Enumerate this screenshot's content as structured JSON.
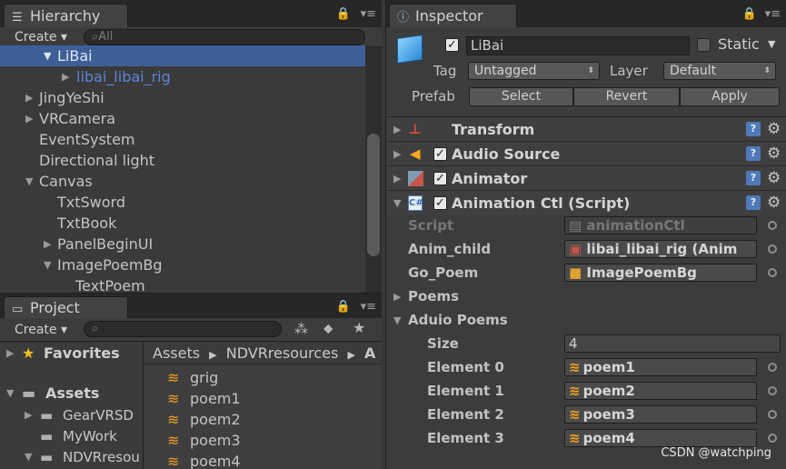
{
  "hierarchy": {
    "tab_label": "Hierarchy",
    "create_label": "Create",
    "search_placeholder": "All",
    "rows": [
      {
        "label": "LiBai",
        "selected": true,
        "arrow": "down"
      },
      {
        "label": "libai_libai_rig",
        "arrow": "right"
      },
      {
        "label": "JingYeShi",
        "arrow": "right"
      },
      {
        "label": "VRCamera",
        "arrow": "right"
      },
      {
        "label": "EventSystem"
      },
      {
        "label": "Directional light"
      },
      {
        "label": "Canvas",
        "arrow": "down"
      },
      {
        "label": "TxtSword"
      },
      {
        "label": "TxtBook"
      },
      {
        "label": "PanelBeginUI",
        "arrow": "right"
      },
      {
        "label": "ImagePoemBg",
        "arrow": "down"
      },
      {
        "label": "TextPoem"
      }
    ]
  },
  "project": {
    "tab_label": "Project",
    "create_label": "Create",
    "favorites_label": "Favorites",
    "assets_label": "Assets",
    "folders": [
      "GearVRSD",
      "MyWork",
      "NDVRresou"
    ],
    "breadcrumb": [
      "Assets",
      "NDVRresources",
      "A"
    ],
    "files": [
      "grig",
      "poem1",
      "poem2",
      "poem3",
      "poem4"
    ]
  },
  "inspector": {
    "tab_label": "Inspector",
    "object_name": "LiBai",
    "static_label": "Static",
    "tag_label": "Tag",
    "tag_value": "Untagged",
    "layer_label": "Layer",
    "layer_value": "Default",
    "prefab_label": "Prefab",
    "prefab_buttons": [
      "Select",
      "Revert",
      "Apply"
    ],
    "components": {
      "transform": "Transform",
      "audio": "Audio Source",
      "animator": "Animator",
      "script": "Animation Ctl (Script)"
    },
    "fields": {
      "script_label": "Script",
      "script_value": "animationCtl",
      "anim_child_label": "Anim_child",
      "anim_child_value": "libai_libai_rig (Anim",
      "go_poem_label": "Go_Poem",
      "go_poem_value": "ImagePoemBg",
      "poems_label": "Poems",
      "aduio_poems_label": "Aduio Poems",
      "size_label": "Size",
      "size_value": "4",
      "elements": [
        {
          "label": "Element 0",
          "value": "poem1"
        },
        {
          "label": "Element 1",
          "value": "poem2"
        },
        {
          "label": "Element 2",
          "value": "poem3"
        },
        {
          "label": "Element 3",
          "value": "poem4"
        }
      ]
    }
  },
  "watermark": "CSDN @watchping",
  "colors": {
    "selection": "#3e5f96",
    "link_text": "#5b86d8",
    "accent_audio": "#f5a623",
    "help_icon": "#4f79b8"
  }
}
